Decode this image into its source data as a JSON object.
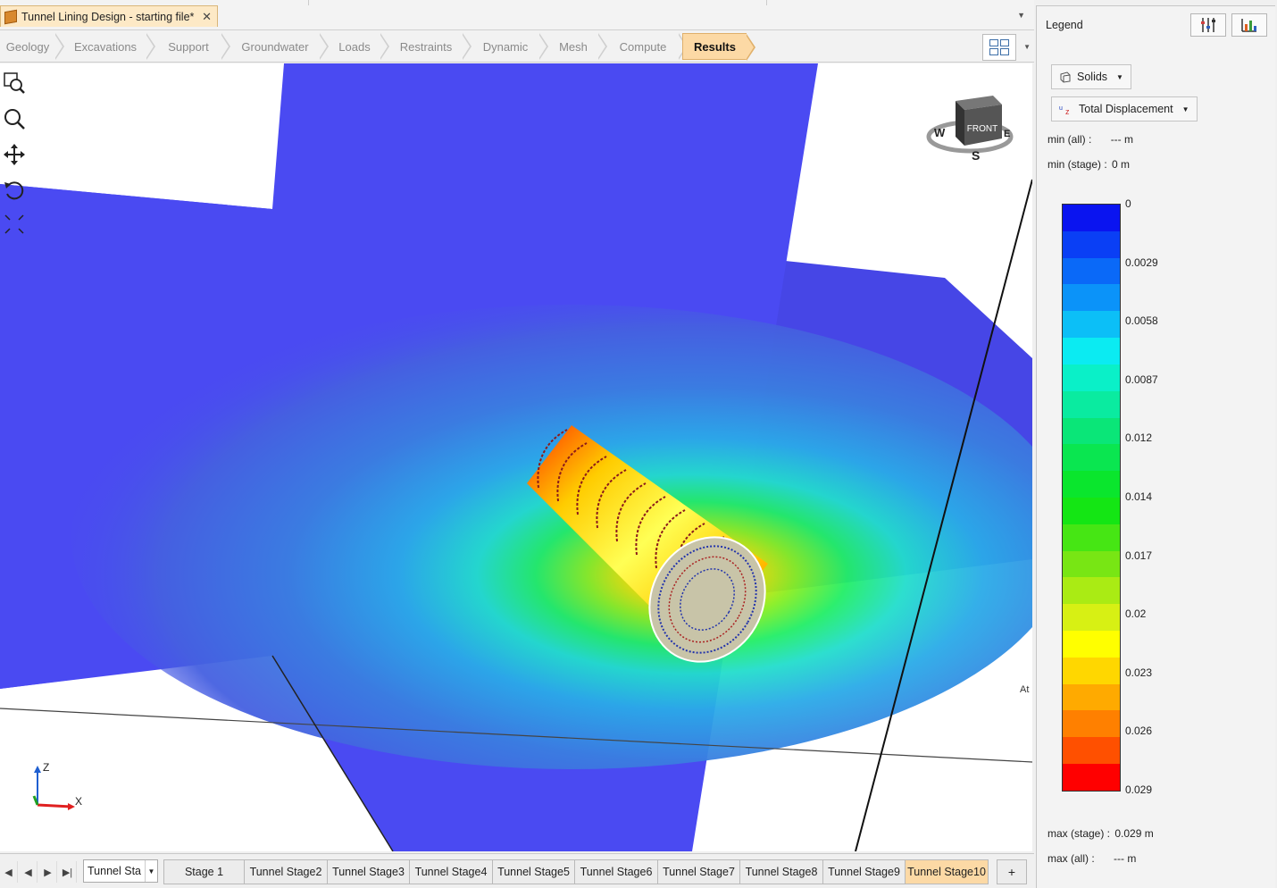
{
  "document_tab": {
    "title": "Tunnel Lining Design - starting file*",
    "close_glyph": "✕"
  },
  "workflow": {
    "steps": [
      "Geology",
      "Excavations",
      "Support",
      "Groundwater",
      "Loads",
      "Restraints",
      "Dynamic",
      "Mesh",
      "Compute",
      "Results"
    ],
    "active_step": "Results"
  },
  "toolbar_tools": [
    "zoom-window-icon",
    "zoom-icon",
    "pan-icon",
    "rotate-icon",
    "zoom-extents-icon"
  ],
  "axis_triad": {
    "z_label": "Z",
    "x_label": "X"
  },
  "view_cube": {
    "face_label": "FRONT",
    "compass": {
      "west": "W",
      "east": "E",
      "south": "S"
    }
  },
  "viewport_edge_text": "At",
  "legend": {
    "title": "Legend",
    "entity_selector": "Solids",
    "result_selector": "Total Displacement",
    "min_all_label": "min (all) :",
    "min_all_value": "--- m",
    "min_stage_label": "min (stage) :",
    "min_stage_value": "0 m",
    "max_stage_label": "max (stage) :",
    "max_stage_value": "0.029 m",
    "max_all_label": "max (all) :",
    "max_all_value": "--- m",
    "scale_labels": [
      "0",
      "0.0029",
      "0.0058",
      "0.0087",
      "0.012",
      "0.014",
      "0.017",
      "0.02",
      "0.023",
      "0.026",
      "0.029"
    ],
    "band_colors": [
      "#0a14f0",
      "#0a3ff5",
      "#0a69f8",
      "#0b93f9",
      "#0cbff7",
      "#0bebf2",
      "#0af0c8",
      "#0aeba0",
      "#0ae678",
      "#0ae650",
      "#0ae62d",
      "#14e614",
      "#46e614",
      "#78e614",
      "#aaeb14",
      "#d7f014",
      "#ffff00",
      "#ffd700",
      "#ffaa00",
      "#ff8000",
      "#ff5000",
      "#ff0000"
    ]
  },
  "stages": {
    "selector_value": "Tunnel Sta",
    "tabs": [
      "Stage 1",
      "Tunnel Stage2",
      "Tunnel Stage3",
      "Tunnel Stage4",
      "Tunnel Stage5",
      "Tunnel Stage6",
      "Tunnel Stage7",
      "Tunnel Stage8",
      "Tunnel Stage9",
      "Tunnel Stage10"
    ],
    "active_tab": "Tunnel Stage10",
    "add_label": "+"
  },
  "colors": {
    "accent_tab": "#fcd9a5",
    "plane_blue": "#4a4af0"
  }
}
